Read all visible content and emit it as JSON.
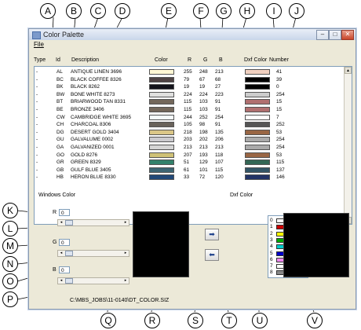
{
  "callouts": {
    "top": [
      "A",
      "B",
      "C",
      "D",
      "E",
      "F",
      "G",
      "H",
      "I",
      "J"
    ],
    "left": [
      "K",
      "L",
      "M",
      "N",
      "O",
      "P"
    ],
    "bottom": [
      "Q",
      "R",
      "S",
      "T",
      "U",
      "V"
    ]
  },
  "window": {
    "title": "Color Palette",
    "min_glyph": "–",
    "max_glyph": "□",
    "close_glyph": "✕",
    "menu_file": "File"
  },
  "table": {
    "headers": {
      "type": "Type",
      "id": "Id",
      "description": "Description",
      "color": "Color",
      "r": "R",
      "g": "G",
      "b": "B",
      "dxf_color": "Dxf Color",
      "number": "Number"
    },
    "rows": [
      {
        "type": "-",
        "id": "AL",
        "desc": "ANTIQUE LINEN 3696",
        "r": "255",
        "g": "248",
        "b": "213",
        "hex": "#fff8d5",
        "dxf": "#f0d0c0",
        "num": "41"
      },
      {
        "type": "-",
        "id": "BC",
        "desc": "BLACK COFFEE 8326",
        "r": "79",
        "g": "67",
        "b": "68",
        "hex": "#4f4344",
        "dxf": "#000000",
        "num": "39"
      },
      {
        "type": "-",
        "id": "BK",
        "desc": "BLACK 8262",
        "r": "19",
        "g": "19",
        "b": "27",
        "hex": "#13131b",
        "dxf": "#000000",
        "num": "0"
      },
      {
        "type": "-",
        "id": "BW",
        "desc": "BONE WHITE 8273",
        "r": "224",
        "g": "224",
        "b": "223",
        "hex": "#e0e0df",
        "dxf": "#cccccc",
        "num": "254"
      },
      {
        "type": "-",
        "id": "BT",
        "desc": "BRIARWOOD TAN 8331",
        "r": "115",
        "g": "103",
        "b": "91",
        "hex": "#73675b",
        "dxf": "#b07070",
        "num": "15"
      },
      {
        "type": "-",
        "id": "BE",
        "desc": "BRONZE 3406",
        "r": "115",
        "g": "103",
        "b": "91",
        "hex": "#73675b",
        "dxf": "#b07070",
        "num": "15"
      },
      {
        "type": "-",
        "id": "CW",
        "desc": "CAMBRIDGE WHITE 3695",
        "r": "244",
        "g": "252",
        "b": "254",
        "hex": "#f4fcfe",
        "dxf": "#ffffff",
        "num": "7"
      },
      {
        "type": "-",
        "id": "CH",
        "desc": "CHARCOAL 8306",
        "r": "105",
        "g": "98",
        "b": "91",
        "hex": "#69625b",
        "dxf": "#555555",
        "num": "252"
      },
      {
        "type": "-",
        "id": "DG",
        "desc": "DESERT GOLD 3404",
        "r": "218",
        "g": "198",
        "b": "135",
        "hex": "#dac687",
        "dxf": "#996644",
        "num": "53"
      },
      {
        "type": "-",
        "id": "GU",
        "desc": "GALVALUME 0002",
        "r": "203",
        "g": "202",
        "b": "206",
        "hex": "#cbcace",
        "dxf": "#aaaaaa",
        "num": "254"
      },
      {
        "type": "-",
        "id": "GA",
        "desc": "GALVANIZED 0001",
        "r": "213",
        "g": "213",
        "b": "213",
        "hex": "#d5d5d5",
        "dxf": "#aaaaaa",
        "num": "254"
      },
      {
        "type": "-",
        "id": "GO",
        "desc": "GOLD 8276",
        "r": "207",
        "g": "193",
        "b": "118",
        "hex": "#cfc176",
        "dxf": "#996644",
        "num": "53"
      },
      {
        "type": "-",
        "id": "GR",
        "desc": "GREEN 8329",
        "r": "51",
        "g": "129",
        "b": "107",
        "hex": "#33816b",
        "dxf": "#336655",
        "num": "115"
      },
      {
        "type": "-",
        "id": "GB",
        "desc": "GULF BLUE 3405",
        "r": "61",
        "g": "101",
        "b": "115",
        "hex": "#3d6573",
        "dxf": "#335566",
        "num": "137"
      },
      {
        "type": "-",
        "id": "HB",
        "desc": "HERON BLUE 8330",
        "r": "33",
        "g": "72",
        "b": "120",
        "hex": "#214878",
        "dxf": "#223366",
        "num": "146"
      }
    ]
  },
  "windows_color": {
    "label": "Windows Color",
    "r_label": "R",
    "g_label": "G",
    "b_label": "B",
    "r_value": "0",
    "g_value": "0",
    "b_value": "0",
    "left_arrow": "◂",
    "right_arrow": "▸"
  },
  "arrows": {
    "to_dxf": "➡",
    "to_windows": "⬅"
  },
  "dxf_color": {
    "label": "Dxf Color",
    "items": [
      {
        "num": "0",
        "hex": "#ffffff"
      },
      {
        "num": "1",
        "hex": "#cc0000"
      },
      {
        "num": "2",
        "hex": "#ffff00"
      },
      {
        "num": "3",
        "hex": "#00aa00"
      },
      {
        "num": "4",
        "hex": "#00cccc"
      },
      {
        "num": "5",
        "hex": "#0000cc"
      },
      {
        "num": "6",
        "hex": "#ee88ee"
      },
      {
        "num": "7",
        "hex": "#ffffff"
      },
      {
        "num": "8",
        "hex": "#888888"
      }
    ]
  },
  "status": {
    "path": "C:\\MBS_JOBS\\11-0140\\DT_COLOR.SIZ"
  }
}
